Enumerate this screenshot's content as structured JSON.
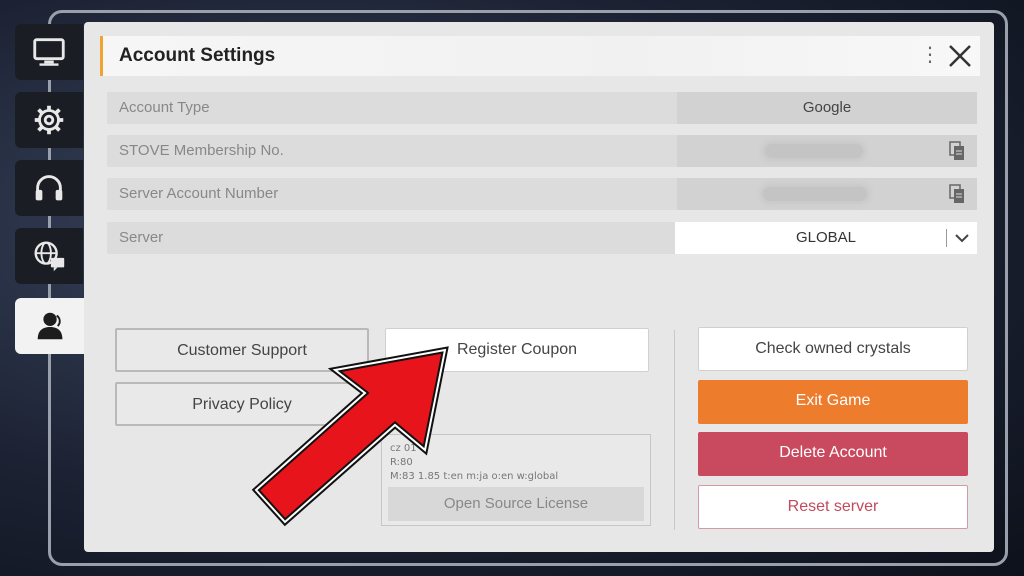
{
  "title": "Account Settings",
  "nav": [
    {
      "icon": "monitor-icon"
    },
    {
      "icon": "gear-icon"
    },
    {
      "icon": "headset-icon"
    },
    {
      "icon": "globe-chat-icon"
    },
    {
      "icon": "user-icon",
      "active": true
    }
  ],
  "rows": {
    "account_type": {
      "label": "Account Type",
      "value": "Google"
    },
    "membership": {
      "label": "STOVE Membership No."
    },
    "server_account": {
      "label": "Server Account Number"
    },
    "server": {
      "label": "Server",
      "value": "GLOBAL"
    }
  },
  "buttons": {
    "customer_support": "Customer Support",
    "privacy_policy": "Privacy Policy",
    "register_coupon": "Register Coupon",
    "check_crystals": "Check owned crystals",
    "exit_game": "Exit Game",
    "delete_account": "Delete Account",
    "reset_server": "Reset server",
    "open_source": "Open Source License"
  },
  "license_info": {
    "line1": "cz      01",
    "line2": "R:80",
    "line3": "M:83 1.85 t:en m:ja o:en w:global"
  },
  "colors": {
    "accent_orange": "#ee7c2d",
    "delete_red": "#c94a5f",
    "title_accent": "#f0a430",
    "arrow_red": "#e8141c"
  }
}
